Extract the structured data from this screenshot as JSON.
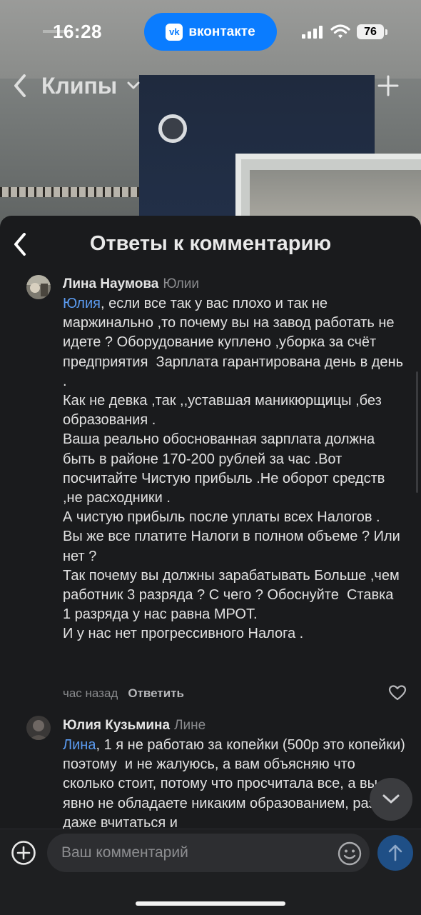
{
  "status_bar": {
    "time": "16:28",
    "app_pill": "вконтакте",
    "vk_logo_text": "vk",
    "battery": "76",
    "icons": [
      "signal-icon",
      "wifi-icon",
      "battery-icon"
    ]
  },
  "clips_header": {
    "title": "Клипы",
    "icons": [
      "back-icon",
      "chevron-down-icon",
      "plus-icon"
    ]
  },
  "sheet": {
    "title": "Ответы к комментарию"
  },
  "comments": [
    {
      "author": "Лина Наумова",
      "reply_to": "Юлии",
      "mention": "Юлия",
      "text": ", если все так у вас плохо и так не маржинально ,то почему вы на завод работать не идете ? Оборудование куплено ,уборка за счёт предприятия  Зарплата гарантирована день в день .\nКак не девка ,так ,,уставшая маникюрщицы ,без образования .\nВаша реально обоснованная зарплата должна быть в районе 170-200 рублей за час .Вот посчитайте Чистую прибыль .Не оборот средств ,не расходники .\nА чистую прибыль после уплаты всех Налогов .\nВы же все платите Налоги в полном объеме ? Или нет ?\nТак почему вы должны зарабатывать Больше ,чем работник 3 разряда ? С чего ? Обоснуйте  Ставка 1 разряда у нас равна МРОТ.\nИ у нас нет прогрессивного Налога .",
      "time": "час назад",
      "reply_label": "Ответить"
    },
    {
      "author": "Юлия Кузьмина",
      "reply_to": "Лине",
      "mention": "Лина",
      "text": ", 1 я не работаю за копейки (500р это копейки) поэтому  и не жалуюсь, а вам объясняю что сколько стоит, потому что просчитала все, а вы явно не обладаете никаким образованием, раз даже вчитаться и"
    }
  ],
  "composer": {
    "placeholder": "Ваш комментарий"
  },
  "colors": {
    "accent": "#0a7cff",
    "mention": "#5b9bf0",
    "background": "#1a1b1d"
  }
}
